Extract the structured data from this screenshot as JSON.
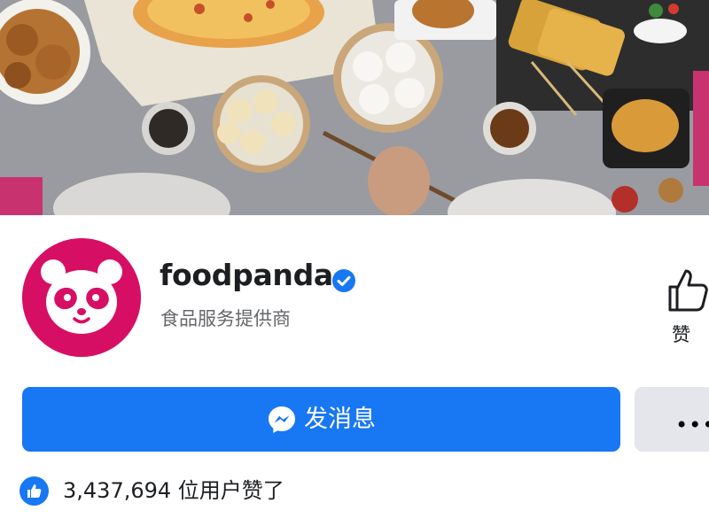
{
  "page": {
    "name": "foodpanda",
    "category": "食品服务提供商",
    "verified_icon": "verified-badge-icon"
  },
  "actions": {
    "like_label": "赞",
    "message_label": "发消息",
    "more_label": "•••"
  },
  "stats": {
    "likes_count": "3,437,694",
    "likes_suffix": "位用户赞了"
  },
  "colors": {
    "brand_pink": "#d70f64",
    "facebook_blue": "#1877f2",
    "secondary_gray": "#e4e6eb",
    "text_gray": "#65676b"
  },
  "icons": [
    "food-cover-photo",
    "panda-logo-icon",
    "verified-badge-icon",
    "thumbs-up-icon",
    "messenger-icon",
    "more-dots-icon",
    "like-badge-icon"
  ]
}
